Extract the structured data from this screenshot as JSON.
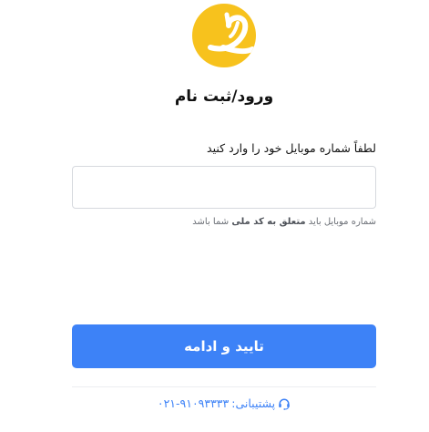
{
  "logo": {
    "icon": "brand-logo-icon",
    "background_color": "#f7c21d"
  },
  "page": {
    "title": "ورود/ثبت نام"
  },
  "form": {
    "phone_label": "لطفاً شماره موبایل خود را وارد کنید",
    "phone_value": "",
    "hint": {
      "prefix": "شماره موبایل باید",
      "emphasis": "متعلق به کد ملی",
      "suffix": "شما باشد"
    },
    "submit_label": "تایید و ادامه",
    "submit_color": "#3d82f7"
  },
  "support": {
    "icon": "headset-icon",
    "label": "پشتیبانی:",
    "number": "۰۲۱-۹۱۰۹۳۳۳۳",
    "color": "#3d82f7"
  }
}
